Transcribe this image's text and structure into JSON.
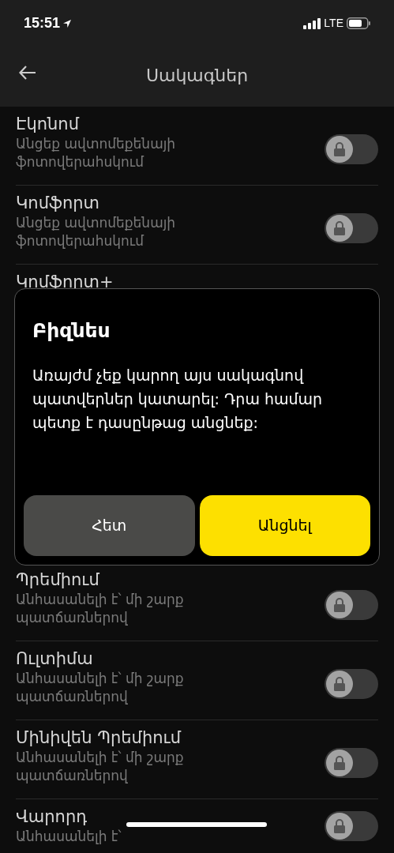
{
  "status_bar": {
    "time": "15:51",
    "network": "LTE"
  },
  "header": {
    "title": "Սակագներ"
  },
  "plans": [
    {
      "name": "Էկոնոմ",
      "note": "Անցեք ավտոմեքենայի ֆոտովերահսկում",
      "on": false,
      "locked": true
    },
    {
      "name": "Կոմֆորտ",
      "note": "Անցեք ավտոմեքենայի ֆոտովերահսկում",
      "on": false,
      "locked": true
    },
    {
      "name": "Կոմֆորտ+"
    }
  ],
  "plans_below": [
    {
      "name": "Պրեմիում",
      "note": "Անհասանելի է՝ մի շարք պատճառներով",
      "on": false,
      "locked": true
    },
    {
      "name": "Ուլտիմա",
      "note": "Անհասանելի է՝ մի շարք պատճառներով",
      "on": false,
      "locked": true
    },
    {
      "name": "Մինիվեն Պրեմիում",
      "note": "Անհասանելի է՝ մի շարք պատճառներով",
      "on": false,
      "locked": true
    },
    {
      "name": "Վարորդ",
      "note": "Անհասանելի է՝",
      "on": false,
      "locked": true
    }
  ],
  "dialog": {
    "title": "Բիզնես",
    "message": "Առայժմ չեք կարող այս սակագնով պատվերներ կատարել: Դրա համար պետք է դասընթաց անցնեք:",
    "buttons": [
      {
        "label": "Հետ",
        "kind": "secondary"
      },
      {
        "label": "Անցնել",
        "kind": "primary"
      }
    ]
  }
}
